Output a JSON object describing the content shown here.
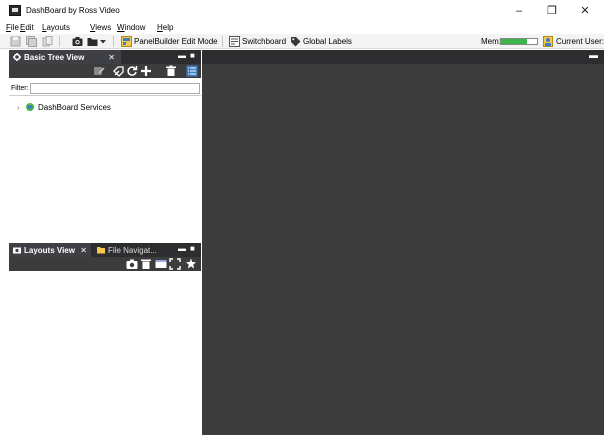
{
  "window": {
    "title": "DashBoard by Ross Video",
    "minimize": "–",
    "maximize": "❐",
    "close": "✕"
  },
  "menu": {
    "items": [
      {
        "first": "F",
        "rest": "ile"
      },
      {
        "first": "E",
        "rest": "dit"
      },
      {
        "first": "L",
        "rest": "ayouts"
      },
      {
        "first": "V",
        "rest": "iews"
      },
      {
        "first": "W",
        "rest": "indow"
      },
      {
        "first": "H",
        "rest": "elp"
      }
    ]
  },
  "toolbar": {
    "panelbuilder_label": "PanelBuilder Edit Mode",
    "switchboard_label": "Switchboard",
    "global_labels_label": "Global Labels",
    "mem_label": "Mem:",
    "mem_usage": 0.72,
    "current_user": "Current User: (non"
  },
  "basic_tree": {
    "tab_label": "Basic Tree View",
    "close": "✕",
    "filter_label": "Filter:",
    "filter_value": "",
    "items": [
      {
        "label": "DashBoard Services"
      }
    ]
  },
  "layouts_panel": {
    "tab_label": "Layouts View",
    "close": "✕",
    "second_tab_label": "File Navigat..."
  },
  "colors": {
    "dark_header": "#2d2d30",
    "panel_toolbar": "#3c3c3c",
    "workspace": "#3c3c3c",
    "mem_fill": "#3cb54a"
  }
}
